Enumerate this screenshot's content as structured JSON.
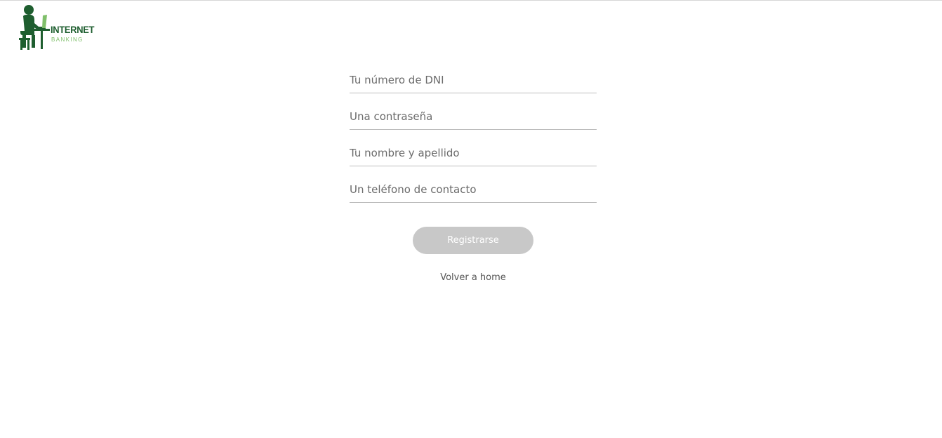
{
  "brand": {
    "title": "INTERNET",
    "subtitle": "BANKING",
    "icon": "person-at-laptop-icon",
    "colors": {
      "primary": "#1e5e2f",
      "accent": "#7fbf6a"
    }
  },
  "form": {
    "fields": [
      {
        "name": "dni",
        "placeholder": "Tu número de DNI",
        "value": ""
      },
      {
        "name": "password",
        "placeholder": "Una contraseña",
        "value": ""
      },
      {
        "name": "fullname",
        "placeholder": "Tu nombre y apellido",
        "value": ""
      },
      {
        "name": "phone",
        "placeholder": "Un teléfono de contacto",
        "value": ""
      }
    ],
    "submit_label": "Registrarse",
    "back_label": "Volver a home"
  },
  "colors": {
    "button_disabled": "#c8c8c8",
    "text": "#555555",
    "underline": "#bdbdbd"
  }
}
